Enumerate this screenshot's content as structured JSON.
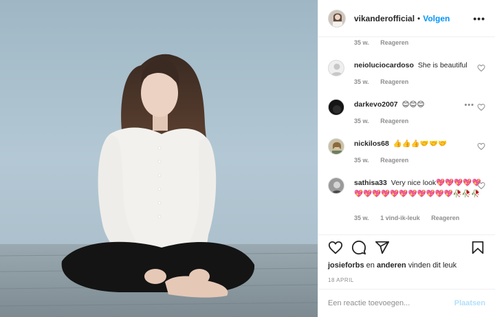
{
  "post_header": {
    "username": "vikanderofficial",
    "separator": "•",
    "follow_label": "Volgen",
    "more_label": "•••"
  },
  "top_meta": {
    "time": "35 w.",
    "reply_label": "Reageren"
  },
  "comments": [
    {
      "username": "neioluciocardoso",
      "text": "She is beautiful",
      "time": "35 w.",
      "reply_label": "Reageren",
      "avatar": "default-avatar-icon"
    },
    {
      "username": "darkevo2007",
      "text": "😊😊😊",
      "time": "35 w.",
      "reply_label": "Reageren",
      "avatar": "dark-avatar",
      "show_more": "•••"
    },
    {
      "username": "nickilos68",
      "text": "👍👍👍🤝🤝🤝",
      "time": "35 w.",
      "reply_label": "Reageren",
      "avatar": "photo-avatar"
    },
    {
      "username": "sathisa33",
      "text": "Very nice look💖💖💖💖💖💖💖💖💖💖💖💖💖💖💖💖🥀🥀🥀",
      "time": "35 w.",
      "likes_label": "1 vind-ik-leuk",
      "reply_label": "Reageren",
      "avatar": "grey-avatar"
    }
  ],
  "actions": {
    "like_icon": "heart-icon",
    "comment_icon": "comment-icon",
    "share_icon": "paper-plane-icon",
    "save_icon": "bookmark-icon"
  },
  "likes_line": {
    "user1": "josieforbs",
    "conj": "en",
    "user2": "anderen",
    "suffix": "vinden dit leuk"
  },
  "post_date": "18 APRIL",
  "add_comment": {
    "placeholder": "Een reactie toevoegen...",
    "post_label": "Plaatsen"
  },
  "colors": {
    "link_blue": "#0095f6",
    "disabled_blue": "#b2dffc",
    "muted": "#8e8e8e",
    "text": "#262626"
  }
}
